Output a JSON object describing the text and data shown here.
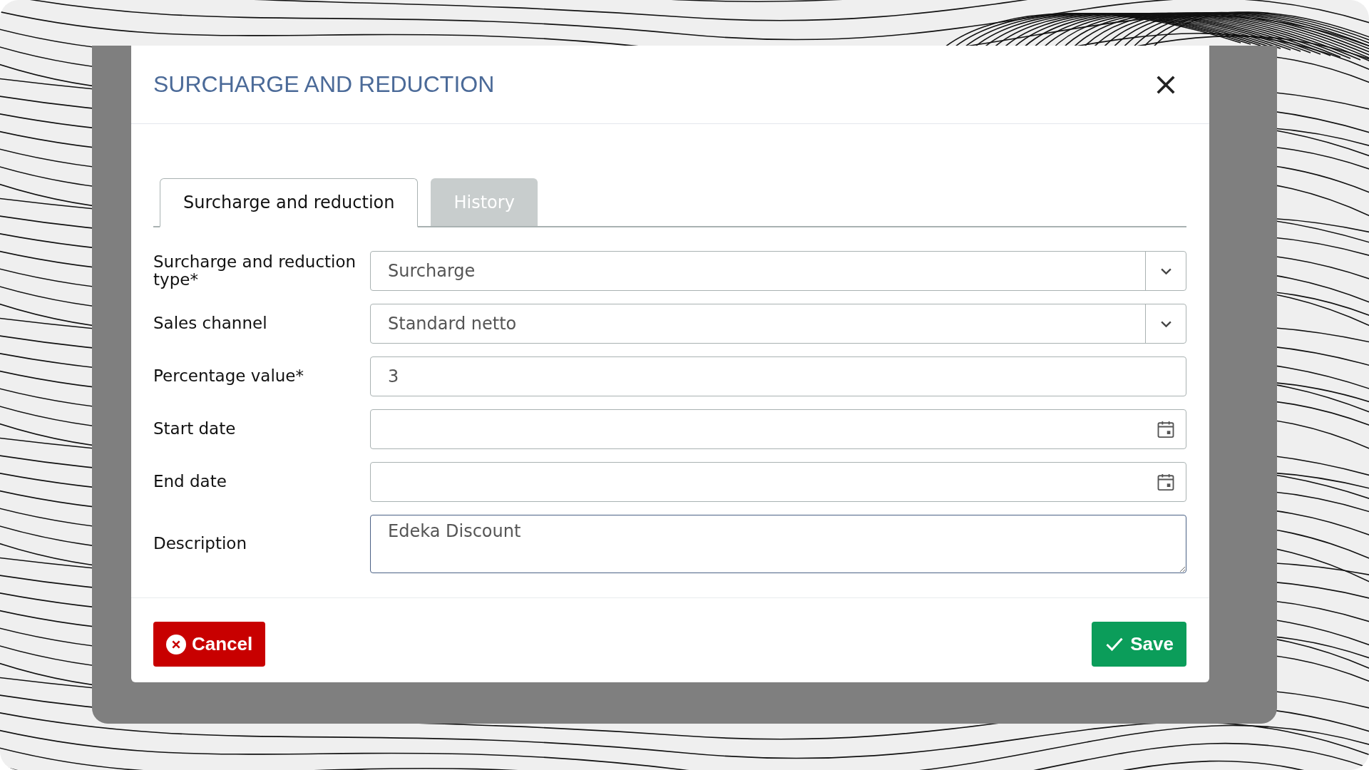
{
  "dialog": {
    "title": "SURCHARGE AND REDUCTION"
  },
  "tabs": [
    {
      "label": "Surcharge and reduction",
      "selected": true
    },
    {
      "label": "History",
      "selected": false
    }
  ],
  "fields": [
    {
      "label": "Surcharge and reduction type*",
      "kind": "select",
      "value": "Surcharge"
    },
    {
      "label": "Sales channel",
      "kind": "select",
      "value": "Standard netto"
    },
    {
      "label": "Percentage value*",
      "kind": "text",
      "value": "3"
    },
    {
      "label": "Start date",
      "kind": "date"
    },
    {
      "label": "End date",
      "kind": "date"
    },
    {
      "label": "Description",
      "kind": "textarea",
      "value": "Edeka Discount",
      "focused": true
    }
  ],
  "buttons": [
    {
      "label": "Cancel",
      "kind": "cancel"
    },
    {
      "label": "Save",
      "kind": "save"
    }
  ]
}
